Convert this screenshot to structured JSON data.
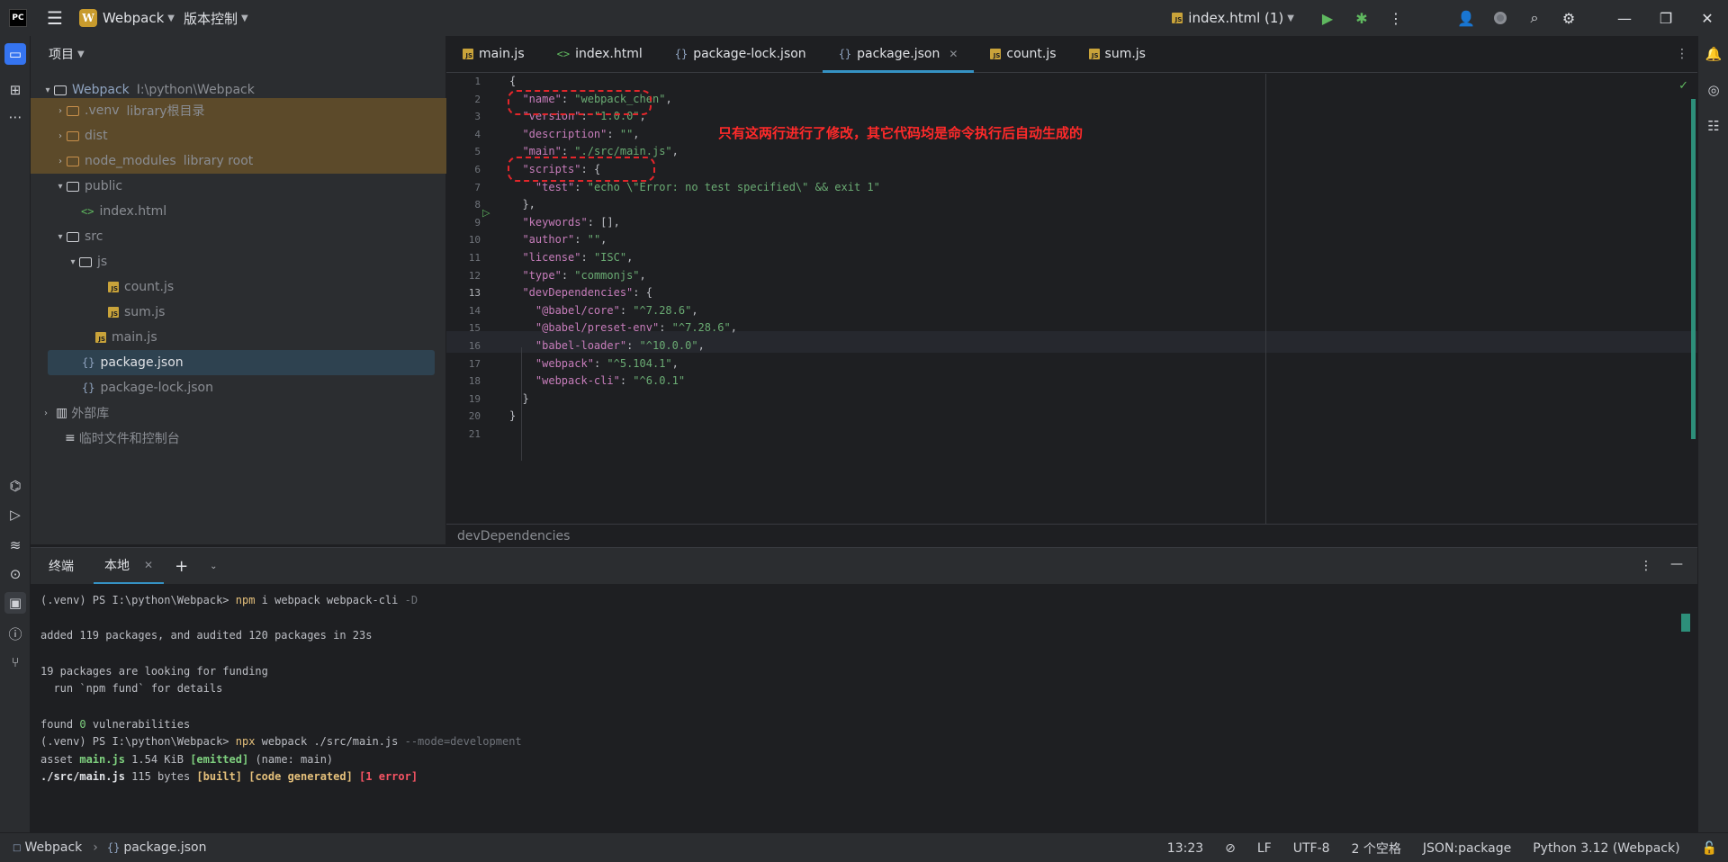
{
  "titlebar": {
    "app_logo": "PC",
    "project_badge": "W",
    "project_name": "Webpack",
    "vcs_label": "版本控制",
    "run_config": "index.html (1)"
  },
  "project_panel": {
    "title": "项目",
    "tree": [
      {
        "label": "Webpack",
        "sub": "I:\\python\\Webpack"
      },
      {
        "label": ".venv",
        "sub": "library根目录"
      },
      {
        "label": "dist",
        "sub": ""
      },
      {
        "label": "node_modules",
        "sub": "library root"
      },
      {
        "label": "public",
        "sub": ""
      },
      {
        "label": "index.html",
        "sub": ""
      },
      {
        "label": "src",
        "sub": ""
      },
      {
        "label": "js",
        "sub": ""
      },
      {
        "label": "count.js",
        "sub": ""
      },
      {
        "label": "sum.js",
        "sub": ""
      },
      {
        "label": "main.js",
        "sub": ""
      },
      {
        "label": "package.json",
        "sub": ""
      },
      {
        "label": "package-lock.json",
        "sub": ""
      },
      {
        "label": "外部库",
        "sub": ""
      },
      {
        "label": "临时文件和控制台",
        "sub": ""
      }
    ]
  },
  "tabs": [
    {
      "label": "main.js",
      "icon": "js-file-icon"
    },
    {
      "label": "index.html",
      "icon": "html-file-icon"
    },
    {
      "label": "package-lock.json",
      "icon": "json-file-icon"
    },
    {
      "label": "package.json",
      "icon": "json-file-icon",
      "active": true
    },
    {
      "label": "count.js",
      "icon": "js-file-icon"
    },
    {
      "label": "sum.js",
      "icon": "js-file-icon"
    }
  ],
  "editor": {
    "line_numbers": [
      "1",
      "2",
      "3",
      "4",
      "5",
      "6",
      "7",
      "8",
      "9",
      "10",
      "11",
      "12",
      "13",
      "14",
      "15",
      "16",
      "17",
      "18",
      "19",
      "20",
      "21"
    ],
    "lines": [
      "{",
      "  \"name\": \"webpack_chen\",",
      "  \"version\": \"1.0.0\",",
      "  \"description\": \"\",",
      "  \"main\": \"./src/main.js\",",
      "  \"scripts\": {",
      "    \"test\": \"echo \\\"Error: no test specified\\\" && exit 1\"",
      "  },",
      "  \"keywords\": [],",
      "  \"author\": \"\",",
      "  \"license\": \"ISC\",",
      "  \"type\": \"commonjs\",",
      "  \"devDependencies\": {",
      "    \"@babel/core\": \"^7.28.6\",",
      "    \"@babel/preset-env\": \"^7.28.6\",",
      "    \"babel-loader\": \"^10.0.0\",",
      "    \"webpack\": \"^5.104.1\",",
      "    \"webpack-cli\": \"^6.0.1\"",
      "  }",
      "}",
      ""
    ],
    "annotation": "只有这两行进行了修改，其它代码均是命令执行后自动生成的",
    "breadcrumb": "devDependencies"
  },
  "terminal": {
    "title": "终端",
    "tab_label": "本地",
    "lines": {
      "l1_prompt": "(.venv) PS I:\\python\\Webpack> ",
      "l1_cmd": "npm",
      "l1_args": " i webpack webpack-cli ",
      "l1_flag": "-D",
      "l2": "added 119 packages, and audited 120 packages in 23s",
      "l3": "19 packages are looking for funding",
      "l4": "  run `npm fund` for details",
      "l5_a": "found ",
      "l5_b": "0",
      "l5_c": " vulnerabilities",
      "l6_prompt": "(.venv) PS I:\\python\\Webpack> ",
      "l6_cmd": "npx",
      "l6_args": " webpack ./src/main.js ",
      "l6_flag": "--mode=development",
      "l7_a": "asset ",
      "l7_b": "main.js",
      "l7_c": " 1.54 KiB ",
      "l7_d": "[emitted]",
      "l7_e": " (name: main)",
      "l8_a": "./src/main.js",
      "l8_b": " 115 bytes ",
      "l8_c": "[built]",
      "l8_d": " ",
      "l8_e": "[code generated]",
      "l8_f": " ",
      "l8_g": "[1 error]"
    }
  },
  "statusbar": {
    "project": "Webpack",
    "file": "package.json",
    "position": "13:23",
    "line_sep": "LF",
    "encoding": "UTF-8",
    "indent": "2 个空格",
    "schema": "JSON:package",
    "interpreter": "Python 3.12 (Webpack)"
  },
  "colors": {
    "accent": "#3574f0",
    "annotation": "#e3262b",
    "excluded": "#5c4a2a",
    "selection": "#2e4250"
  }
}
